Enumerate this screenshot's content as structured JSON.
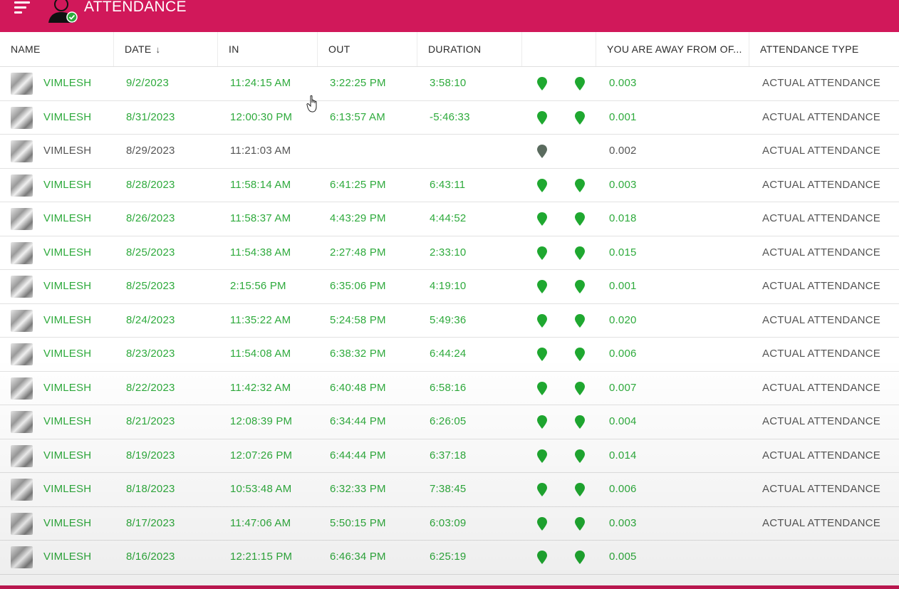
{
  "app": {
    "title": "ATTENDANCE"
  },
  "colors": {
    "header": "#d1185a",
    "present": "#2eaa3c",
    "pin_active": "#1fa830",
    "pin_inactive": "#5a6b5e"
  },
  "columns": {
    "name": "NAME",
    "date": "DATE",
    "in": "IN",
    "out": "OUT",
    "duration": "DURATION",
    "distance": "YOU ARE AWAY FROM OF...",
    "type": "ATTENDANCE TYPE"
  },
  "rows": [
    {
      "name": "VIMLESH",
      "date": "9/2/2023",
      "in": "11:24:15 AM",
      "out": "3:22:25 PM",
      "duration": "3:58:10",
      "distance": "0.003",
      "type": "ACTUAL ATTENDANCE",
      "complete": true
    },
    {
      "name": "VIMLESH",
      "date": "8/31/2023",
      "in": "12:00:30 PM",
      "out": "6:13:57 AM",
      "duration": "-5:46:33",
      "distance": "0.001",
      "type": "ACTUAL ATTENDANCE",
      "complete": true
    },
    {
      "name": "VIMLESH",
      "date": "8/29/2023",
      "in": "11:21:03 AM",
      "out": "",
      "duration": "",
      "distance": "0.002",
      "type": "ACTUAL ATTENDANCE",
      "complete": false
    },
    {
      "name": "VIMLESH",
      "date": "8/28/2023",
      "in": "11:58:14 AM",
      "out": "6:41:25 PM",
      "duration": "6:43:11",
      "distance": "0.003",
      "type": "ACTUAL ATTENDANCE",
      "complete": true
    },
    {
      "name": "VIMLESH",
      "date": "8/26/2023",
      "in": "11:58:37 AM",
      "out": "4:43:29 PM",
      "duration": "4:44:52",
      "distance": "0.018",
      "type": "ACTUAL ATTENDANCE",
      "complete": true
    },
    {
      "name": "VIMLESH",
      "date": "8/25/2023",
      "in": "11:54:38 AM",
      "out": "2:27:48 PM",
      "duration": "2:33:10",
      "distance": "0.015",
      "type": "ACTUAL ATTENDANCE",
      "complete": true
    },
    {
      "name": "VIMLESH",
      "date": "8/25/2023",
      "in": "2:15:56 PM",
      "out": "6:35:06 PM",
      "duration": "4:19:10",
      "distance": "0.001",
      "type": "ACTUAL ATTENDANCE",
      "complete": true
    },
    {
      "name": "VIMLESH",
      "date": "8/24/2023",
      "in": "11:35:22 AM",
      "out": "5:24:58 PM",
      "duration": "5:49:36",
      "distance": "0.020",
      "type": "ACTUAL ATTENDANCE",
      "complete": true
    },
    {
      "name": "VIMLESH",
      "date": "8/23/2023",
      "in": "11:54:08 AM",
      "out": "6:38:32 PM",
      "duration": "6:44:24",
      "distance": "0.006",
      "type": "ACTUAL ATTENDANCE",
      "complete": true
    },
    {
      "name": "VIMLESH",
      "date": "8/22/2023",
      "in": "11:42:32 AM",
      "out": "6:40:48 PM",
      "duration": "6:58:16",
      "distance": "0.007",
      "type": "ACTUAL ATTENDANCE",
      "complete": true
    },
    {
      "name": "VIMLESH",
      "date": "8/21/2023",
      "in": "12:08:39 PM",
      "out": "6:34:44 PM",
      "duration": "6:26:05",
      "distance": "0.004",
      "type": "ACTUAL ATTENDANCE",
      "complete": true
    },
    {
      "name": "VIMLESH",
      "date": "8/19/2023",
      "in": "12:07:26 PM",
      "out": "6:44:44 PM",
      "duration": "6:37:18",
      "distance": "0.014",
      "type": "ACTUAL ATTENDANCE",
      "complete": true
    },
    {
      "name": "VIMLESH",
      "date": "8/18/2023",
      "in": "10:53:48 AM",
      "out": "6:32:33 PM",
      "duration": "7:38:45",
      "distance": "0.006",
      "type": "ACTUAL ATTENDANCE",
      "complete": true
    },
    {
      "name": "VIMLESH",
      "date": "8/17/2023",
      "in": "11:47:06 AM",
      "out": "5:50:15 PM",
      "duration": "6:03:09",
      "distance": "0.003",
      "type": "ACTUAL ATTENDANCE",
      "complete": true
    },
    {
      "name": "VIMLESH",
      "date": "8/16/2023",
      "in": "12:21:15 PM",
      "out": "6:46:34 PM",
      "duration": "6:25:19",
      "distance": "0.005",
      "type": "",
      "complete": true
    }
  ]
}
